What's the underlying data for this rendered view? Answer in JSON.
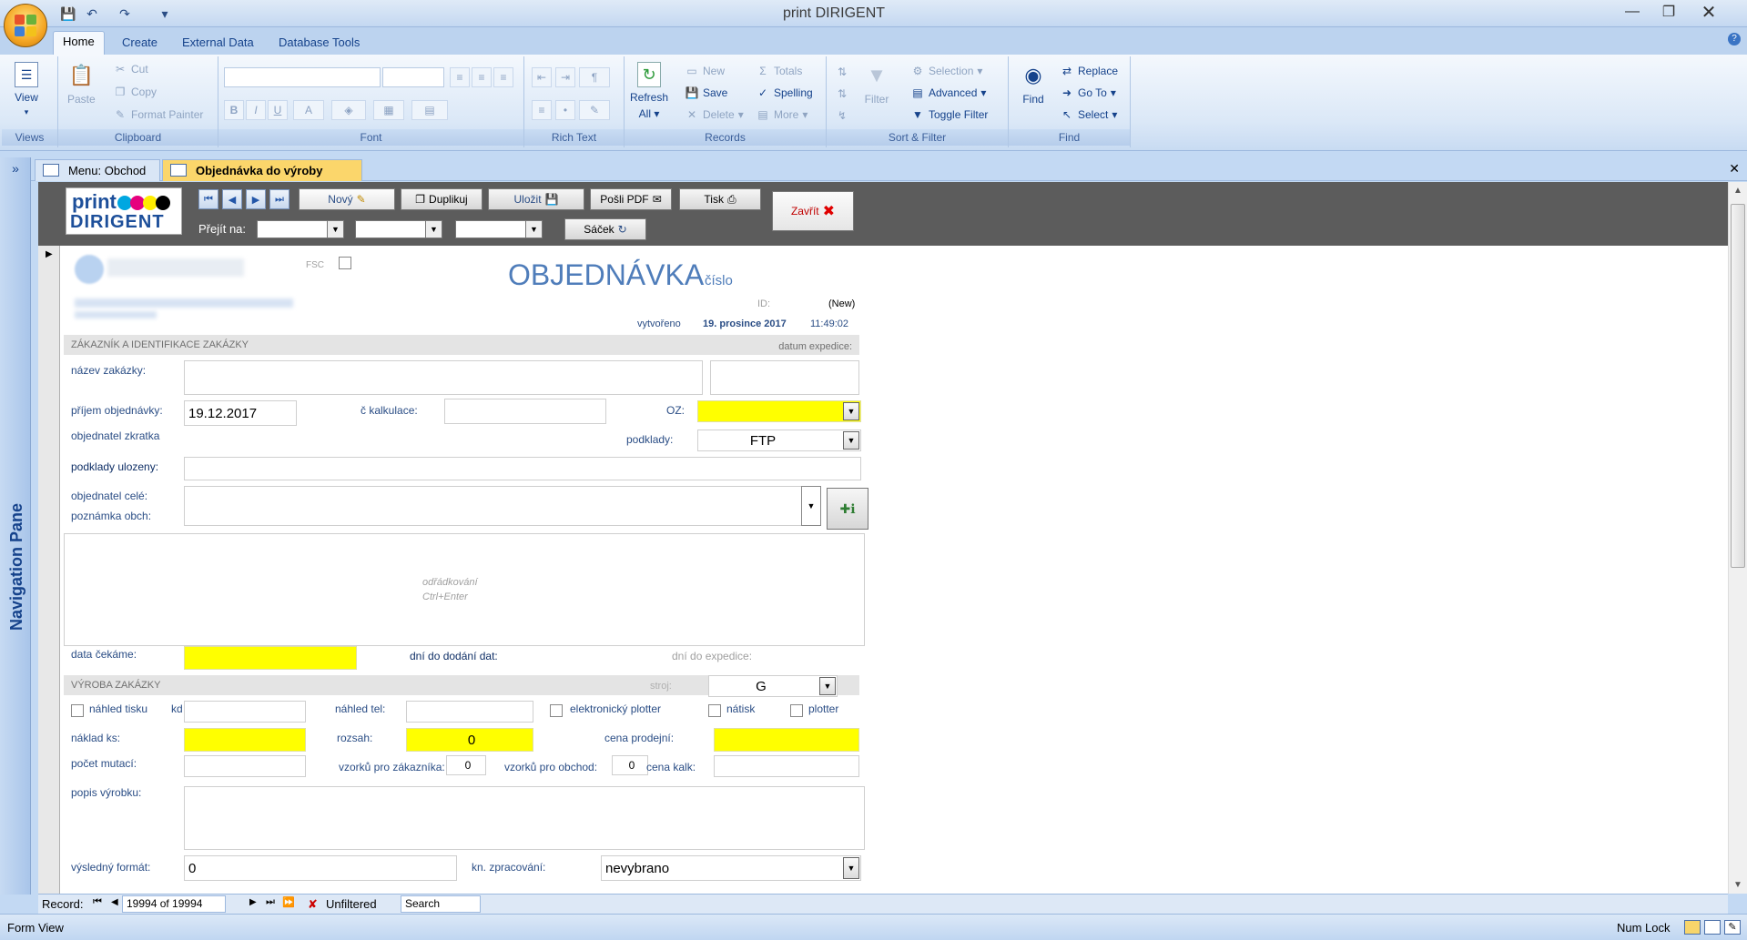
{
  "window": {
    "title": "print DIRIGENT"
  },
  "ribbon_tabs": [
    "Home",
    "Create",
    "External Data",
    "Database Tools"
  ],
  "ribbon": {
    "views": {
      "view": "View",
      "group": "Views"
    },
    "clipboard": {
      "paste": "Paste",
      "cut": "Cut",
      "copy": "Copy",
      "format_painter": "Format Painter",
      "group": "Clipboard"
    },
    "font": {
      "group": "Font",
      "bold": "B",
      "italic": "I",
      "underline": "U",
      "color": "A"
    },
    "rich_text": {
      "group": "Rich Text"
    },
    "records": {
      "refresh": "Refresh",
      "refresh2": "All",
      "new": "New",
      "save": "Save",
      "delete": "Delete",
      "totals": "Totals",
      "spelling": "Spelling",
      "more": "More",
      "group": "Records"
    },
    "sort_filter": {
      "filter": "Filter",
      "selection": "Selection",
      "advanced": "Advanced",
      "toggle_filter": "Toggle Filter",
      "group": "Sort & Filter"
    },
    "find": {
      "find": "Find",
      "replace": "Replace",
      "goto": "Go To",
      "select": "Select",
      "group": "Find"
    }
  },
  "nav_pane": {
    "label": "Navigation Pane"
  },
  "doc_tabs": [
    {
      "label": "Menu: Obchod"
    },
    {
      "label": "Objednávka do výroby"
    }
  ],
  "header": {
    "logo_top": "print",
    "logo_bottom": "DIRIGENT",
    "novy": "Nový",
    "duplikuj": "Duplikuj",
    "ulozit": "Uložit",
    "posli_pdf": "Pošli PDF",
    "tisk": "Tisk",
    "zavrit": "Zavřít",
    "sacek": "Sáček",
    "prejit_na": "Přejít na:"
  },
  "form": {
    "title": "OBJEDNÁVKA",
    "title_sub": "číslo",
    "fsc": "FSC",
    "id_label": "ID:",
    "id_value": "(New)",
    "created_label": "vytvořeno",
    "created_date": "19. prosince 2017",
    "created_time": "11:49:02",
    "section_customer": "ZÁKAZNÍK A IDENTIFIKACE ZAKÁZKY",
    "datum_expedice": "datum expedice:",
    "nazev_zakazky": "název zakázky:",
    "prijem_objednavky": "příjem objednávky:",
    "prijem_value": "19.12.2017",
    "c_kalkulace": "č kalkulace:",
    "oz": "OZ:",
    "objednatel_zkratka": "objednatel zkratka",
    "podklady": "podklady:",
    "podklady_value": "FTP",
    "podklady_ulozeny": "podklady ulozeny:",
    "objednatel_cele": "objednatel celé:",
    "poznamka_obch": "poznámka obch:",
    "odradkovani": "odřádkování",
    "ctrl_enter": "Ctrl+Enter",
    "data_cekame": "data čekáme:",
    "dni_do_dodani": "dní do dodání dat:",
    "dni_do_expedice": "dní do expedice:",
    "section_vyroba": "VÝROBA ZAKÁZKY",
    "stroj": "stroj:",
    "stroj_value": "G",
    "nahled_tisku": "náhled tisku",
    "kd": "kd",
    "nahled_tel": "náhled tel:",
    "elektronicky_plotter": "elektronický plotter",
    "natisk": "nátisk",
    "plotter": "plotter",
    "naklad_ks": "náklad ks:",
    "rozsah": "rozsah:",
    "rozsah_value": "0",
    "cena_prodejni": "cena prodejní:",
    "pocet_mutaci": "počet mutací:",
    "vzorku_zakaznika": "vzorků pro zákazníka:",
    "vzorku_zakaznika_value": "0",
    "vzorku_obchod": "vzorků pro obchod:",
    "vzorku_obchod_value": "0",
    "cena_kalk": "cena kalk:",
    "popis_vyrobku": "popis výrobku:",
    "vysledny_format": "výsledný formát:",
    "vysledny_format_value": "0",
    "kn_zpracovani": "kn. zpracování:",
    "kn_zpracovani_value": "nevybrano"
  },
  "record_nav": {
    "record": "Record:",
    "position": "19994 of 19994",
    "unfiltered": "Unfiltered",
    "search": "Search"
  },
  "status": {
    "view": "Form View",
    "numlock": "Num Lock"
  }
}
